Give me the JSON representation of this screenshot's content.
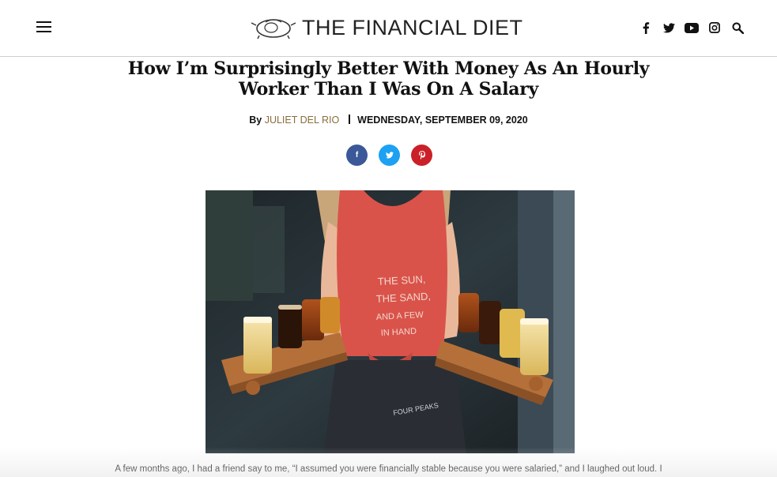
{
  "header": {
    "logo_text": "THE FINANCIAL DIET",
    "social": [
      {
        "name": "facebook-icon"
      },
      {
        "name": "twitter-icon"
      },
      {
        "name": "youtube-icon"
      },
      {
        "name": "instagram-icon"
      },
      {
        "name": "search-icon"
      }
    ]
  },
  "article": {
    "title": "How I’m Surprisingly Better With Money As An Hourly Worker Than I Was On A Salary",
    "by_label": "By",
    "author": "JULIET DEL RIO",
    "date": "WEDNESDAY, SEPTEMBER 09, 2020",
    "share": [
      {
        "label": "f",
        "color": "#3b5998"
      },
      {
        "label": "t",
        "color": "#1da1f2"
      },
      {
        "label": "p",
        "color": "#cb2027"
      }
    ],
    "hero_shirt_text": [
      "THE SUN,",
      "THE SAND,",
      "AND A FEW",
      "IN HAND"
    ],
    "hero_logo_text": "FOUR PEAKS",
    "first_paragraph": "A few months ago, I had a friend say to me, “I assumed you were financially stable because you were salaried,” and I laughed out loud. I"
  },
  "colors": {
    "author": "#8a6d3b",
    "facebook": "#3b5998",
    "twitter": "#1da1f2",
    "pinterest": "#cb2027",
    "shirt": "#d9534a"
  }
}
